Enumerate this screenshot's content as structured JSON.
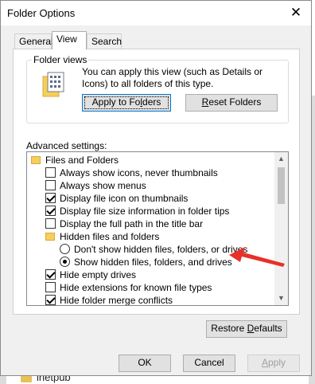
{
  "window": {
    "title": "Folder Options",
    "close_glyph": "✕"
  },
  "tabs": [
    {
      "label": "General",
      "active": false
    },
    {
      "label": "View",
      "active": true
    },
    {
      "label": "Search",
      "active": false
    }
  ],
  "folder_views": {
    "group_label": "Folder views",
    "description": "You can apply this view (such as Details or Icons) to all folders of this type.",
    "icon": "folder-views-icon",
    "apply_button": {
      "prefix": "Apply to Fo",
      "mnemonic": "l",
      "suffix": "ders"
    },
    "reset_button": {
      "prefix": "",
      "mnemonic": "R",
      "suffix": "eset Folders"
    }
  },
  "advanced": {
    "label": "Advanced settings:",
    "items": [
      {
        "type": "folder",
        "label": "Files and Folders",
        "checked": false
      },
      {
        "type": "checkbox",
        "label": "Always show icons, never thumbnails",
        "checked": false
      },
      {
        "type": "checkbox",
        "label": "Always show menus",
        "checked": false
      },
      {
        "type": "checkbox",
        "label": "Display file icon on thumbnails",
        "checked": true
      },
      {
        "type": "checkbox",
        "label": "Display file size information in folder tips",
        "checked": true
      },
      {
        "type": "checkbox",
        "label": "Display the full path in the title bar",
        "checked": false
      },
      {
        "type": "folder",
        "label": "Hidden files and folders",
        "checked": false
      },
      {
        "type": "radio",
        "label": "Don't show hidden files, folders, or drives",
        "checked": false
      },
      {
        "type": "radio",
        "label": "Show hidden files, folders, and drives",
        "checked": true
      },
      {
        "type": "checkbox",
        "label": "Hide empty drives",
        "checked": true
      },
      {
        "type": "checkbox",
        "label": "Hide extensions for known file types",
        "checked": false
      },
      {
        "type": "checkbox",
        "label": "Hide folder merge conflicts",
        "checked": true
      }
    ]
  },
  "buttons": {
    "restore": {
      "prefix": "Restore ",
      "mnemonic": "D",
      "suffix": "efaults"
    },
    "ok": "OK",
    "cancel": "Cancel",
    "apply": {
      "prefix": "",
      "mnemonic": "A",
      "suffix": "pply"
    }
  },
  "background": {
    "folder_label": "inetpub"
  },
  "colors": {
    "accent": "#0078d7",
    "annotation_arrow": "#e8302a",
    "folder": "#f5cf5b"
  }
}
